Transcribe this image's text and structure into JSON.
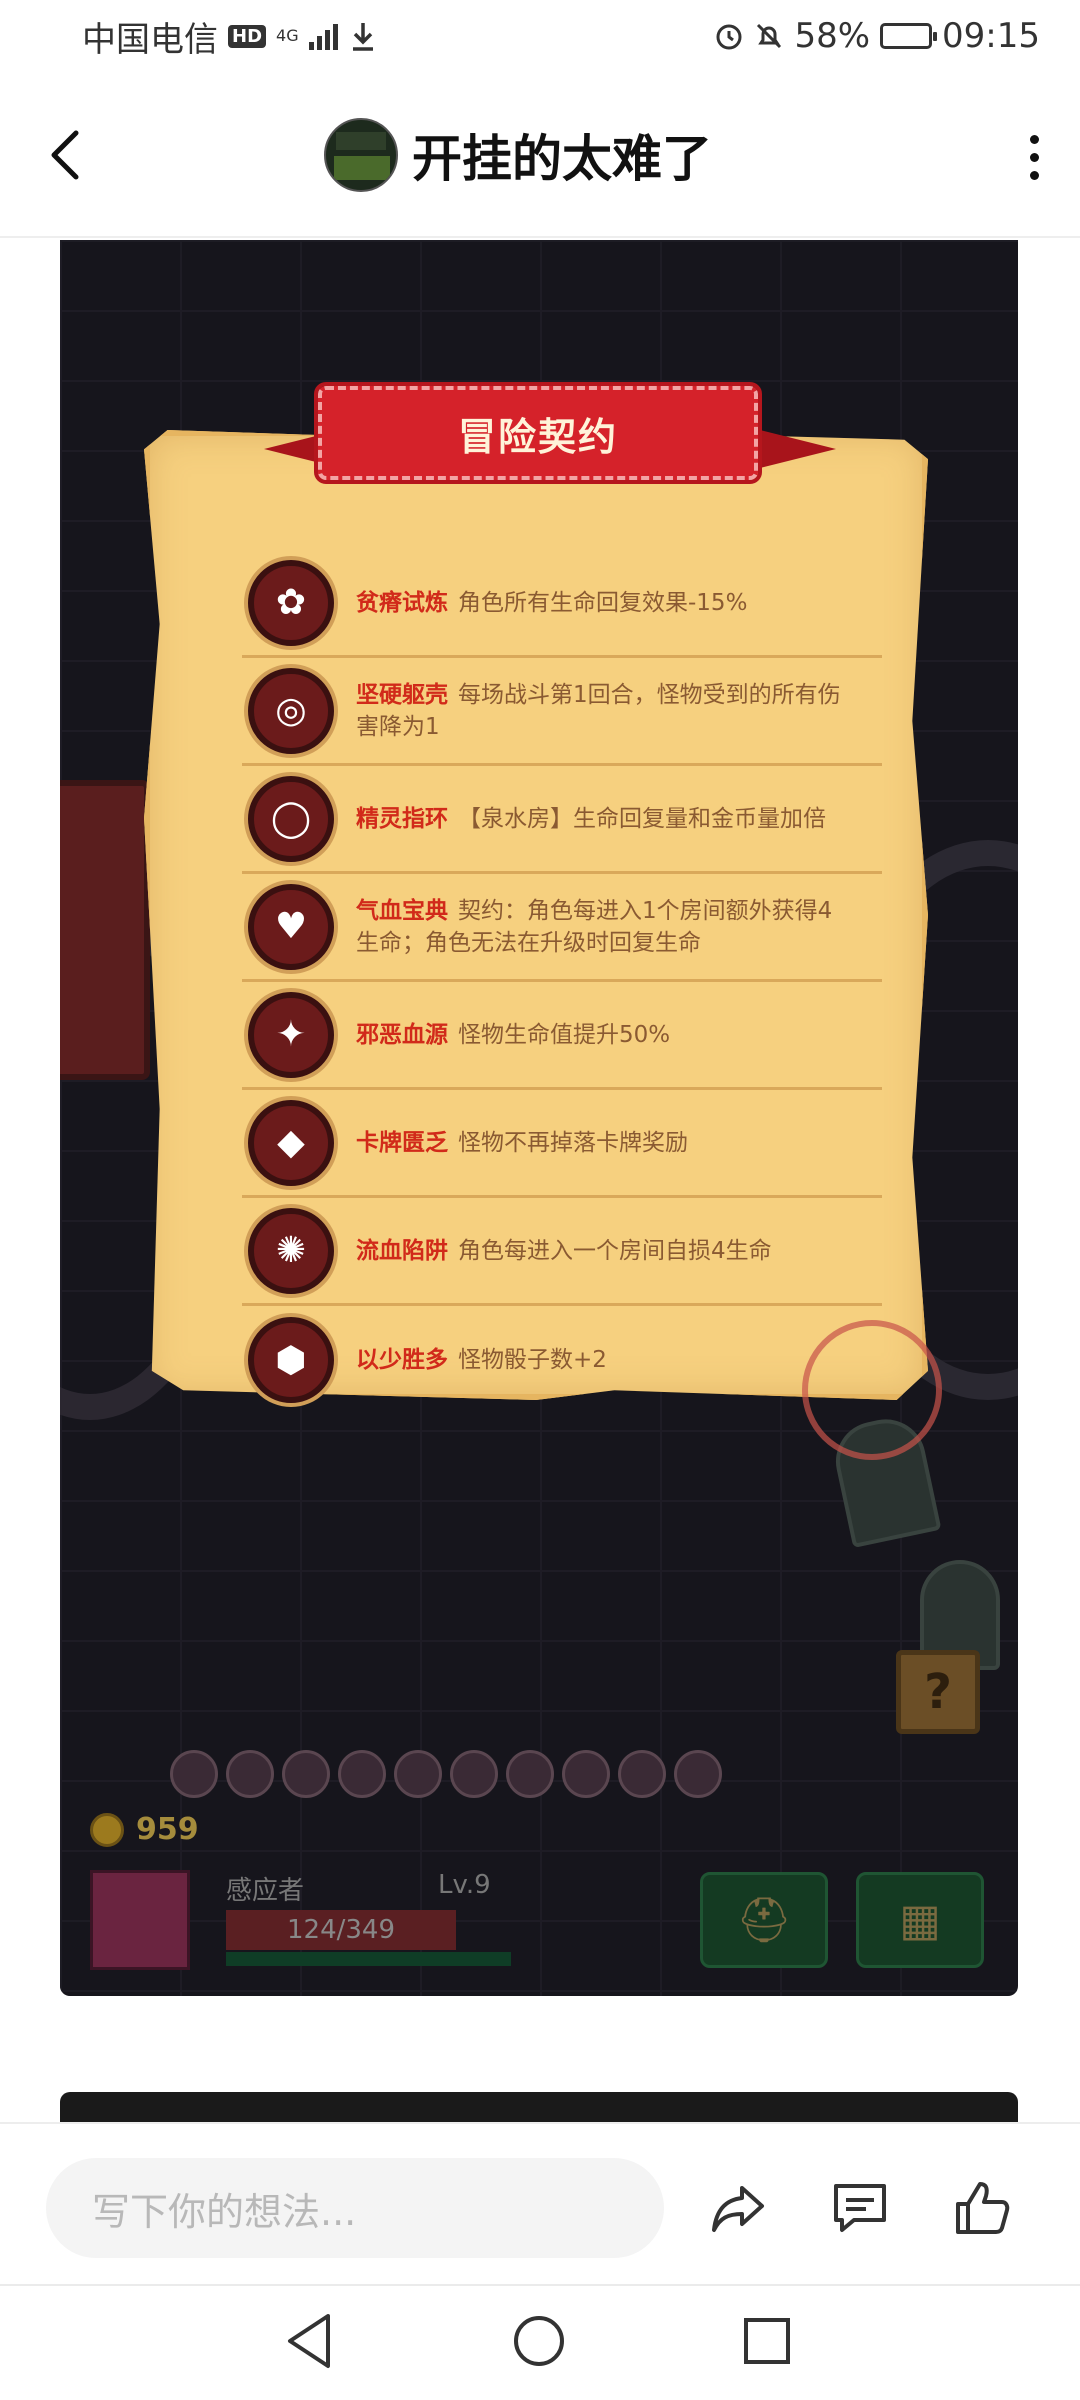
{
  "status_bar": {
    "carrier": "中国电信",
    "hd": "HD",
    "network": "4G",
    "battery_percent": "58%",
    "battery_level": 0.58,
    "time": "09:15"
  },
  "header": {
    "title": "开挂的太难了"
  },
  "game": {
    "banner_title": "冒险契约",
    "contracts": [
      {
        "name": "贫瘠试炼",
        "desc": "角色所有生命回复效果-15%",
        "icon": "mushroom-icon"
      },
      {
        "name": "坚硬躯壳",
        "desc": "每场战斗第1回合，怪物受到的所有伤害降为1",
        "icon": "shell-icon"
      },
      {
        "name": "精灵指环",
        "desc": "【泉水房】生命回复量和金币量加倍",
        "icon": "ring-icon"
      },
      {
        "name": "气血宝典",
        "desc": "契约：角色每进入1个房间额外获得4生命；角色无法在升级时回复生命",
        "icon": "heart-book-icon"
      },
      {
        "name": "邪恶血源",
        "desc": "怪物生命值提升50%",
        "icon": "blood-source-icon"
      },
      {
        "name": "卡牌匮乏",
        "desc": "怪物不再掉落卡牌奖励",
        "icon": "card-icon"
      },
      {
        "name": "流血陷阱",
        "desc": "角色每进入一个房间自损4生命",
        "icon": "trap-icon"
      },
      {
        "name": "以少胜多",
        "desc": "怪物骰子数+2",
        "icon": "dice-icon"
      }
    ],
    "hud": {
      "coins": "959",
      "player_name": "感应者",
      "level": "Lv.9",
      "hp": "124/349"
    }
  },
  "comment_bar": {
    "placeholder": "写下你的想法..."
  },
  "colors": {
    "contract_name": "#d12a1a",
    "banner": "#d5222a",
    "parchment": "#f6d07f"
  }
}
